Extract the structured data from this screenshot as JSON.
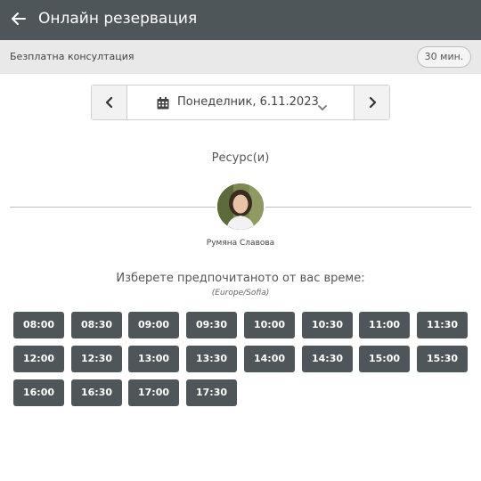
{
  "header": {
    "title": "Онлайн резервация"
  },
  "service": {
    "name": "Безплатна консултация",
    "duration": "30 мин."
  },
  "date_nav": {
    "date": "Понеделник, 6.11.2023"
  },
  "resources": {
    "heading": "Ресурс(и)",
    "name": "Румяна Славова"
  },
  "times": {
    "prompt": "Изберете предпочитаното от вас време:",
    "timezone": "(Europe/Sofia)",
    "slots": [
      "08:00",
      "08:30",
      "09:00",
      "09:30",
      "10:00",
      "10:30",
      "11:00",
      "11:30",
      "12:00",
      "12:30",
      "13:00",
      "13:30",
      "14:00",
      "14:30",
      "15:00",
      "15:30",
      "16:00",
      "16:30",
      "17:00",
      "17:30"
    ]
  },
  "colors": {
    "header_bg": "#4f5659",
    "slot_bg": "#4f5659",
    "service_bar_bg": "#e9e9e9"
  },
  "icons": [
    "arrow-left-icon",
    "chevron-left-icon",
    "calendar-icon",
    "chevron-down-icon",
    "chevron-right-icon"
  ]
}
